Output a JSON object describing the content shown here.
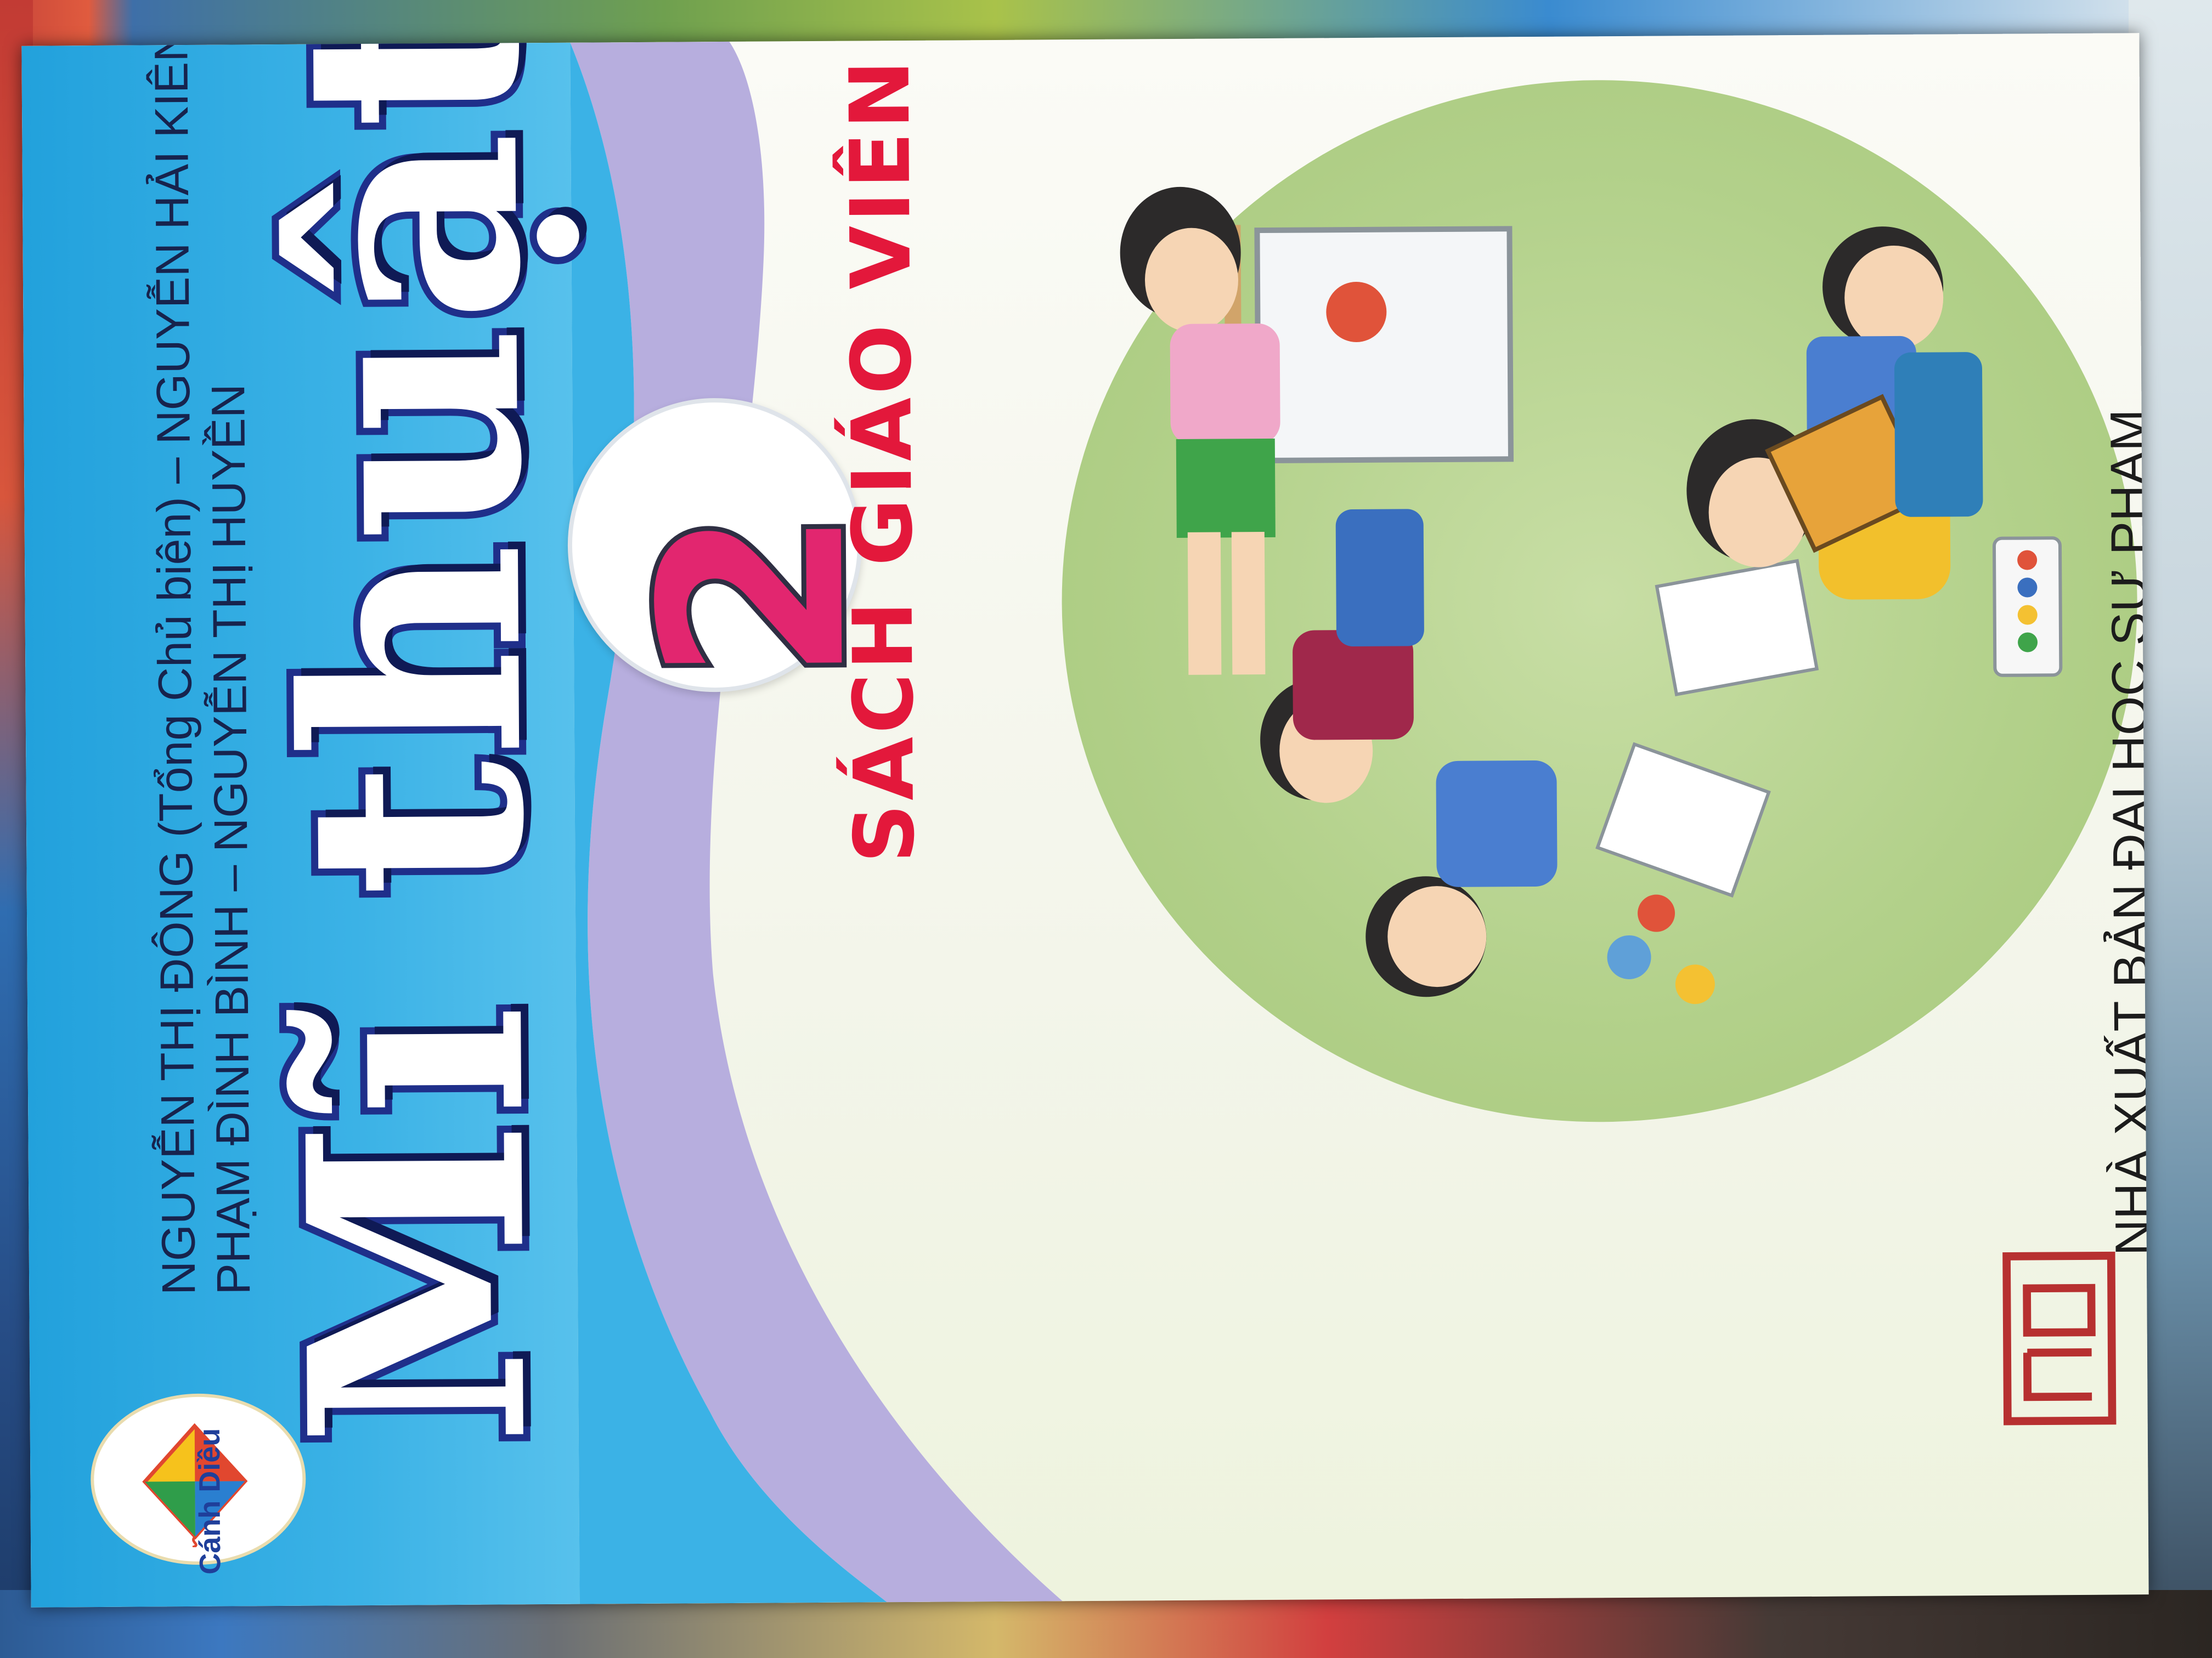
{
  "book": {
    "title": "Mĩ thuật",
    "grade": "2",
    "subtitle": "SÁCH GIÁO VIÊN",
    "authors": [
      "NGUYỄN THỊ ĐÔNG (Tổng Chủ biên) – NGUYỄN HẢI KIÊN (Chủ biên)",
      "PHẠM ĐÌNH BÌNH – NGUYỄN THỊ HUYỀN"
    ],
    "series_logo": "Cánh Diều",
    "publisher": "NHÀ XUẤT BẢN ĐẠI HỌC SƯ PHẠM"
  },
  "colors": {
    "blue_band": "#22a1dc",
    "title_outline": "#1f2f8a",
    "grade_pink": "#e2266f",
    "subtitle_red": "#e3183b",
    "illustration_green": "#b3d18b",
    "wave_purple": "#b7aede"
  },
  "icons": [
    "kite-logo-icon",
    "publisher-logo-icon"
  ],
  "illustration": "children-painting-illustration"
}
